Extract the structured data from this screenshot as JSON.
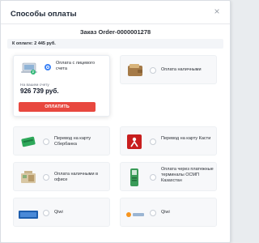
{
  "modal": {
    "title": "Способы оплаты",
    "close_glyph": "×",
    "order_title": "Заказ Order-0000001278",
    "amount_text": "К оплате: 2 445 руб."
  },
  "methods": [
    {
      "label": "Оплата с лицевого счета",
      "selected": true,
      "balance_label": "На вашем счету",
      "balance_value": "926 739 руб.",
      "button": "ОПЛАТИТЬ"
    },
    {
      "label": "Оплата наличными",
      "selected": false
    },
    {
      "label": "Перевод на карту Сбербанка",
      "selected": false
    },
    {
      "label": "Перевод на карту Касти",
      "selected": false
    },
    {
      "label": "Оплата наличными в офисе",
      "selected": false
    },
    {
      "label": "Оплата через платежные терминалы ОСМП Казахстан",
      "selected": false
    },
    {
      "label": "Qiwi",
      "selected": false
    },
    {
      "label": "Qiwi",
      "selected": false
    }
  ],
  "colors": {
    "accent": "#e8483f",
    "radio_active": "#3b82f6"
  }
}
